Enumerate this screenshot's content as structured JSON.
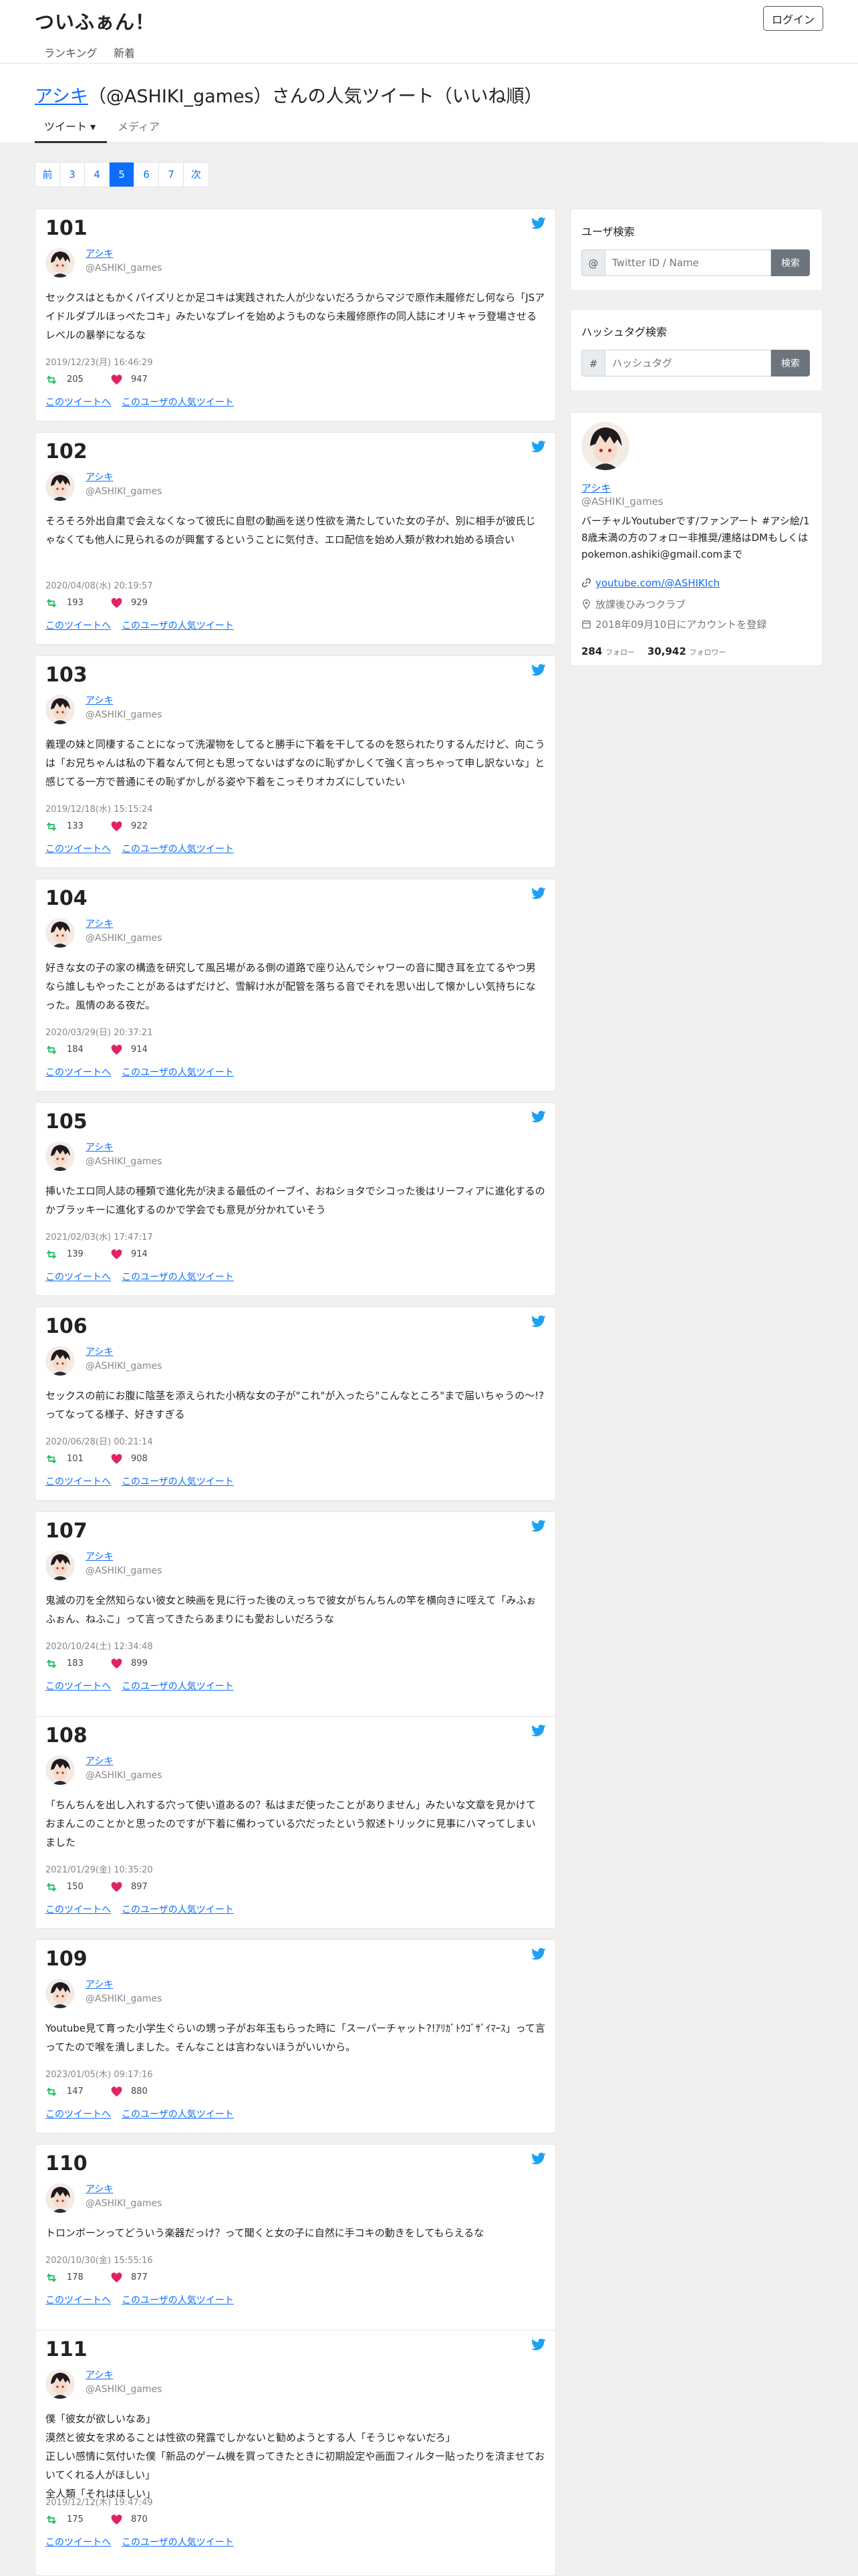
{
  "site": {
    "brand": "ついふぁん！",
    "login_label": "ログイン",
    "nav": [
      "ランキング",
      "新着"
    ]
  },
  "page": {
    "title_user": "アシキ",
    "title_rest": "（@ASHIKI_games）さんの人気ツイート（いいね順）",
    "tabs": [
      {
        "label": "ツイート ▾",
        "active": true
      },
      {
        "label": "メディア",
        "active": false
      }
    ],
    "pagination": [
      "前",
      "3",
      "4",
      "5",
      "6",
      "7",
      "次"
    ],
    "current_page": "5"
  },
  "colors": {
    "accent": "#0d6efd",
    "twitter": "#1da1f2",
    "retweet": "#17bf63",
    "like": "#e0245e"
  },
  "icons": {
    "twitter": "twitter-bird-icon",
    "retweet": "retweet-icon",
    "like": "heart-icon",
    "link": "link-icon",
    "location": "location-pin-icon",
    "calendar": "calendar-icon"
  },
  "tweets": [
    {
      "rank": "101",
      "name": "アシキ",
      "handle": "@ASHIKI_games",
      "text": "セックスはともかくパイズリとか足コキは実践された人が少ないだろうからマジで原作未履修だし何なら「JSアイドルダブルほっぺたコキ」みたいなプレイを始めようものなら未履修原作の同人誌にオリキャラ登場させるレベルの暴挙になるな",
      "date": "2019/12/23(月) 16:46:29",
      "retweets": "205",
      "likes": "947",
      "link1": "このツイートへ",
      "link2": "このユーザの人気ツイート"
    },
    {
      "rank": "102",
      "name": "アシキ",
      "handle": "@ASHIKI_games",
      "text": "そろそろ外出自粛で会えなくなって彼氏に自慰の動画を送り性欲を満たしていた女の子が、別に相手が彼氏じゃなくても他人に見られるのが興奮するということに気付き、エロ配信を始め人類が救われ始める頃合い",
      "date": "2020/04/08(水) 20:19:57",
      "retweets": "193",
      "likes": "929",
      "link1": "このツイートへ",
      "link2": "このユーザの人気ツイート"
    },
    {
      "rank": "103",
      "name": "アシキ",
      "handle": "@ASHIKI_games",
      "text": "義理の妹と同棲することになって洗濯物をしてると勝手に下着を干してるのを怒られたりするんだけど、向こうは「お兄ちゃんは私の下着なんて何とも思ってないはずなのに恥ずかしくて強く言っちゃって申し訳ないな」と感じてる一方で普通にその恥ずかしがる姿や下着をこっそりオカズにしていたい",
      "date": "2019/12/18(水) 15:15:24",
      "retweets": "133",
      "likes": "922",
      "link1": "このツイートへ",
      "link2": "このユーザの人気ツイート"
    },
    {
      "rank": "104",
      "name": "アシキ",
      "handle": "@ASHIKI_games",
      "text": "好きな女の子の家の構造を研究して風呂場がある側の道路で座り込んでシャワーの音に聞き耳を立てるやつ男なら誰しもやったことがあるはずだけど、雪解け水が配管を落ちる音でそれを思い出して懐かしい気持ちになった。風情のある夜だ。",
      "date": "2020/03/29(日) 20:37:21",
      "retweets": "184",
      "likes": "914",
      "link1": "このツイートへ",
      "link2": "このユーザの人気ツイート"
    },
    {
      "rank": "105",
      "name": "アシキ",
      "handle": "@ASHIKI_games",
      "text": "挿いたエロ同人誌の種類で進化先が決まる最低のイーブイ、おねショタでシコった後はリーフィアに進化するのかブラッキーに進化するのかで学会でも意見が分かれていそう",
      "date": "2021/02/03(水) 17:47:17",
      "retweets": "139",
      "likes": "914",
      "link1": "このツイートへ",
      "link2": "このユーザの人気ツイート"
    },
    {
      "rank": "106",
      "name": "アシキ",
      "handle": "@ASHIKI_games",
      "text": "セックスの前にお腹に陰茎を添えられた小柄な女の子が\"これ\"が入ったら\"こんなところ\"まで届いちゃうの〜!?ってなってる様子、好きすぎる",
      "date": "2020/06/28(日) 00:21:14",
      "retweets": "101",
      "likes": "908",
      "link1": "このツイートへ",
      "link2": "このユーザの人気ツイート"
    },
    {
      "rank": "107",
      "name": "アシキ",
      "handle": "@ASHIKI_games",
      "text": "鬼滅の刃を全然知らない彼女と映画を見に行った後のえっちで彼女がちんちんの竿を横向きに咥えて「みふぉふぉん、ねふこ」って言ってきたらあまりにも愛おしいだろうな",
      "date": "2020/10/24(土) 12:34:48",
      "retweets": "183",
      "likes": "899",
      "link1": "このツイートへ",
      "link2": "このユーザの人気ツイート"
    },
    {
      "rank": "108",
      "name": "アシキ",
      "handle": "@ASHIKI_games",
      "text": "「ちんちんを出し入れする穴って使い道あるの？私はまだ使ったことがありません」みたいな文章を見かけておまんこのことかと思ったのですが下着に備わっている穴だったという叙述トリックに見事にハマってしまいました",
      "date": "2021/01/29(金) 10:35:20",
      "retweets": "150",
      "likes": "897",
      "link1": "このツイートへ",
      "link2": "このユーザの人気ツイート"
    },
    {
      "rank": "109",
      "name": "アシキ",
      "handle": "@ASHIKI_games",
      "text": "Youtube見て育った小学生ぐらいの甥っ子がお年玉もらった時に「スーパーチャット?!ｱﾘｶﾞﾄｳｺﾞｻﾞｲﾏｰｽ」って言ってたので喉を潰しました。そんなことは言わないほうがいいから。",
      "date": "2023/01/05(木) 09:17:16",
      "retweets": "147",
      "likes": "880",
      "link1": "このツイートへ",
      "link2": "このユーザの人気ツイート"
    },
    {
      "rank": "110",
      "name": "アシキ",
      "handle": "@ASHIKI_games",
      "text": "トロンボーンってどういう楽器だっけ？って聞くと女の子に自然に手コキの動きをしてもらえるな",
      "date": "2020/10/30(金) 15:55:16",
      "retweets": "178",
      "likes": "877",
      "link1": "このツイートへ",
      "link2": "このユーザの人気ツイート"
    },
    {
      "rank": "111",
      "name": "アシキ",
      "handle": "@ASHIKI_games",
      "text": "僕「彼女が欲しいなあ」\n漠然と彼女を求めることは性欲の発露でしかないと勧めようとする人「そうじゃないだろ」\n正しい感情に気付いた僕「新品のゲーム機を買ってきたときに初期設定や画面フィルター貼ったりを済ませておいてくれる人がほしい」\n全人類「それはほしい」",
      "date": "2019/12/12(木) 19:47:49",
      "retweets": "175",
      "likes": "870",
      "link1": "このツイートへ",
      "link2": "このユーザの人気ツイート"
    }
  ],
  "sidebar": {
    "user_search": {
      "title": "ユーザ検索",
      "prefix": "@",
      "placeholder": "Twitter ID / Name",
      "button": "検索"
    },
    "hashtag_search": {
      "title": "ハッシュタグ検索",
      "prefix": "#",
      "placeholder": "ハッシュタグ",
      "button": "検索"
    },
    "profile": {
      "name": "アシキ",
      "handle": "@ASHIKI_games",
      "bio": "バーチャルYoutuberです/ファンアート #アシ絵/18歳未満の方のフォロー非推奨/連絡はDMもしくはpokemon.ashiki@gmail.comまで",
      "url": "youtube.com/@ASHIKIch",
      "location": "放課後ひみつクラブ",
      "joined": "2018年09月10日にアカウントを登録",
      "following": "284",
      "following_label": "フォロー",
      "followers": "30,942",
      "followers_label": "フォロワー"
    }
  }
}
